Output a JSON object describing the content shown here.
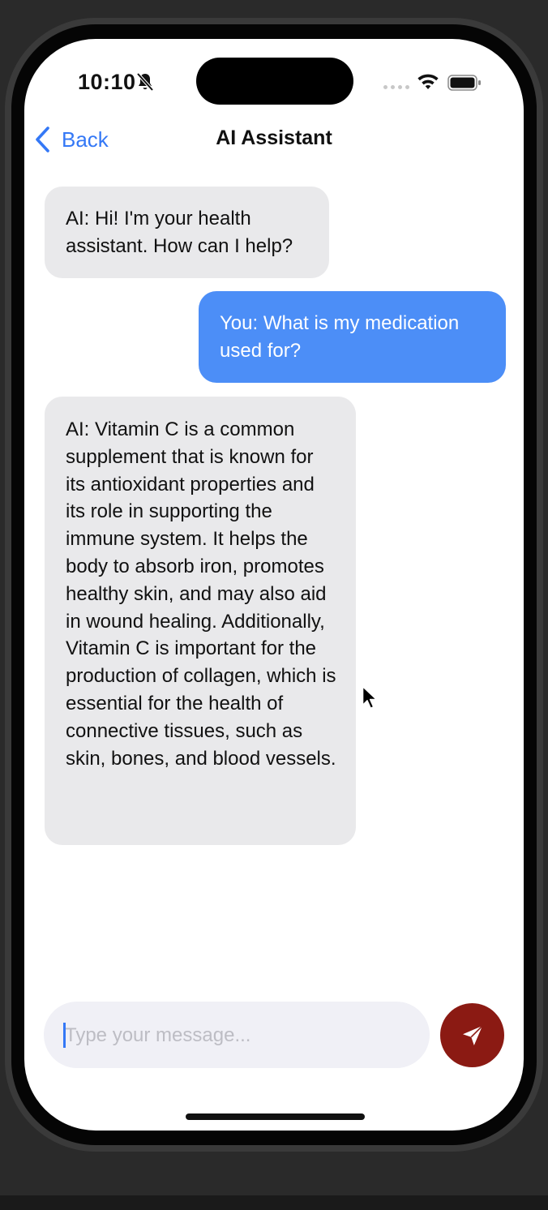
{
  "status_bar": {
    "time": "10:10",
    "icons": [
      "bell-slash-icon",
      "cellular-icon",
      "wifi-icon",
      "battery-icon"
    ]
  },
  "nav": {
    "back_label": "Back",
    "title": "AI Assistant"
  },
  "messages": [
    {
      "sender": "ai",
      "text": "AI: Hi! I'm your health assistant. How can I help?"
    },
    {
      "sender": "user",
      "text": "You: What is my medication used for?"
    },
    {
      "sender": "ai",
      "text": "AI: Vitamin C is a common supplement that is known for its antioxidant properties and its role in supporting the immune system. It helps the body to absorb iron, promotes healthy skin, and may also aid in wound healing. Additionally, Vitamin C is important for the production of collagen, which is essential for the health of connective tissues, such as skin, bones, and blood vessels."
    }
  ],
  "composer": {
    "placeholder": "Type your message...",
    "value": "",
    "send_icon": "paper-plane-icon"
  },
  "colors": {
    "accent_blue": "#3478f6",
    "user_bubble": "#4c8ef7",
    "ai_bubble": "#e9e9eb",
    "send_button": "#8b1a13"
  }
}
